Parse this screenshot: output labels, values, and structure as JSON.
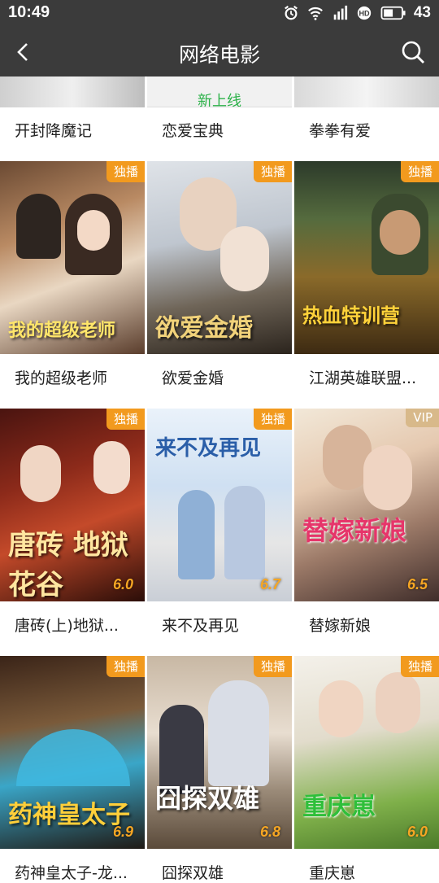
{
  "status_bar": {
    "time": "10:49",
    "battery": "43"
  },
  "app_bar": {
    "title": "网络电影"
  },
  "top_row": {
    "new_label": "新上线",
    "items": [
      "开封降魔记",
      "恋爱宝典",
      "拳拳有爱"
    ]
  },
  "movies": [
    {
      "title": "我的超级老师",
      "badge": "独播",
      "score": "",
      "poster_text": "我的超级老师"
    },
    {
      "title": "欲爱金婚",
      "badge": "独播",
      "score": "",
      "poster_text": "欲爱金婚"
    },
    {
      "title": "江湖英雄联盟...",
      "badge": "独播",
      "score": "",
      "poster_text": "热血特训营"
    },
    {
      "title": "唐砖(上)地狱...",
      "badge": "独播",
      "score": "6.0",
      "poster_text": "唐砖 地狱花谷"
    },
    {
      "title": "来不及再见",
      "badge": "独播",
      "score": "6.7",
      "poster_text": "来不及再见"
    },
    {
      "title": "替嫁新娘",
      "badge": "VIP",
      "score": "6.5",
      "poster_text": "替嫁新娘"
    },
    {
      "title": "药神皇太子-龙...",
      "badge": "独播",
      "score": "6.9",
      "poster_text": "药神皇太子"
    },
    {
      "title": "囧探双雄",
      "badge": "独播",
      "score": "6.8",
      "poster_text": "囧探双雄"
    },
    {
      "title": "重庆崽",
      "badge": "独播",
      "score": "6.0",
      "poster_text": "重庆崽"
    }
  ],
  "colors": {
    "bar": "#3b3b3b",
    "badge": "#f29a1e",
    "vip": "#d8b98a",
    "new": "#2db24a"
  }
}
